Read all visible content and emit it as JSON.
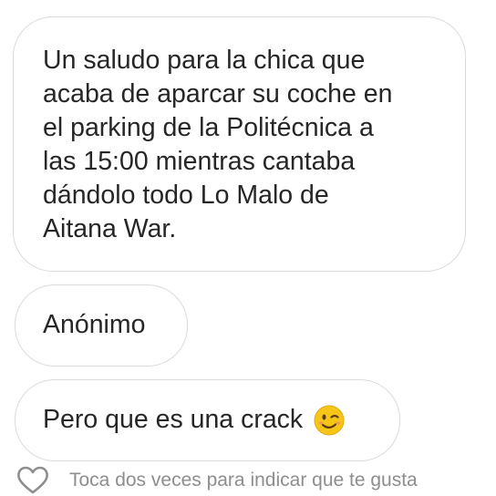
{
  "messages": {
    "main": {
      "lines": [
        "Un saludo para la chica que",
        "acaba de aparcar su coche en",
        "el parking de la Politécnica a",
        "las 15:00 mientras cantaba",
        "dándolo todo Lo Malo de",
        "Aitana War."
      ]
    },
    "sender": {
      "text": "Anónimo"
    },
    "reply": {
      "text": "Pero que es una crack",
      "emoji": "wink-emoji"
    }
  },
  "footer": {
    "icon": "heart-outline-icon",
    "hint": "Toca dos veces para indicar que te gusta"
  },
  "colors": {
    "text": "#262626",
    "bubble_border": "#dbdbdb",
    "hint_text": "#8e8e8e",
    "emoji": "#f5c518"
  }
}
